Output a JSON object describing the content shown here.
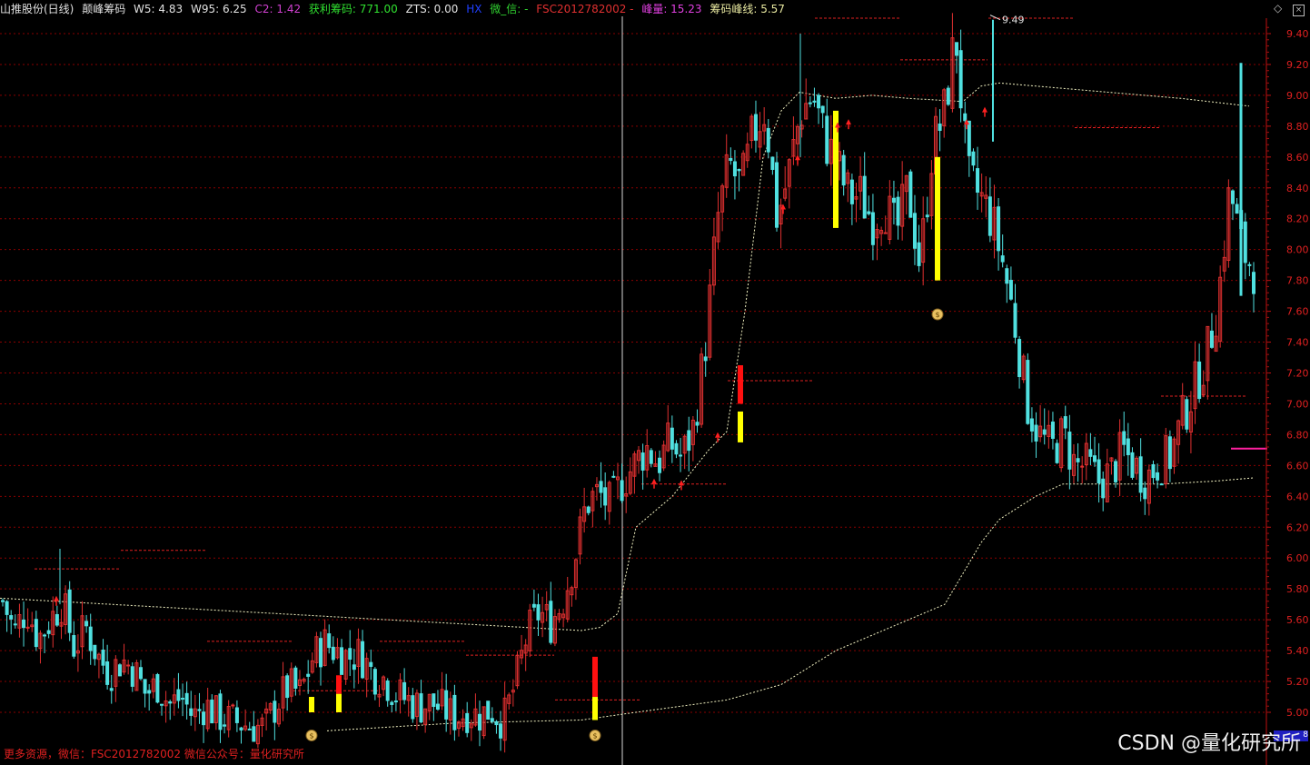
{
  "header": {
    "stock_name": "山推股份(日线)",
    "indicator_name": "颠峰筹码",
    "w5": "W5: 4.83",
    "w95": "W95: 6.25",
    "c2": "C2: 1.42",
    "profit_chips": "获利筹码: 771.00",
    "zts": "ZTS: 0.00",
    "hx": "HX",
    "weixin": "微_信: -",
    "fsc": "FSC2012782002 -",
    "peak": "峰量: 15.23",
    "ridge": "筹码峰线: 5.57"
  },
  "top_icons": [
    "diamond-icon",
    "close-box-icon"
  ],
  "footer_note": "更多资源，微信：FSC2012782002 微信公众号：量化研究所",
  "watermark": "CSDN @量化研究所",
  "corner_tag": "8",
  "max_label": "9.49",
  "colors": {
    "up": "#e03030",
    "down": "#50e0e0",
    "grid": "#8a0000",
    "axis_text": "#e02020",
    "ma": "#f0f0c0",
    "signal_yellow": "#ffff00",
    "signal_red": "#ff1010",
    "magenta": "#ff20a0"
  },
  "chart_data": {
    "type": "candlestick",
    "title": "",
    "ylim": [
      4.85,
      9.55
    ],
    "yticks": [
      "9.40",
      "9.20",
      "9.00",
      "8.80",
      "8.60",
      "8.40",
      "8.20",
      "8.00",
      "7.80",
      "7.60",
      "7.40",
      "7.20",
      "7.00",
      "6.80",
      "6.60",
      "6.40",
      "6.20",
      "6.00",
      "5.80",
      "5.60",
      "5.40",
      "5.20",
      "5.00"
    ],
    "grid": true,
    "close_anchors": [
      5.72,
      5.52,
      5.68,
      5.48,
      5.6,
      5.72,
      5.42,
      5.55,
      5.36,
      5.26,
      5.34,
      5.28,
      5.12,
      5.18,
      5.05,
      5.1,
      4.97,
      5.05,
      4.98,
      4.95,
      4.93,
      4.91,
      4.9,
      5.06,
      5.17,
      5.12,
      5.35,
      5.45,
      5.4,
      5.36,
      5.38,
      5.26,
      5.22,
      5.12,
      5.08,
      5.04,
      5.06,
      5.02,
      4.97,
      5.0,
      4.98,
      5.02,
      4.94,
      5.18,
      5.5,
      5.65,
      5.58,
      5.72,
      6.0,
      6.36,
      6.42,
      6.34,
      6.5,
      6.6,
      6.72,
      6.62,
      6.75,
      6.65,
      6.85,
      7.4,
      8.2,
      8.55,
      8.4,
      8.75,
      8.92,
      8.2,
      8.5,
      8.9,
      9.0,
      8.72,
      8.55,
      8.35,
      8.35,
      8.2,
      8.3,
      8.1,
      8.4,
      7.9,
      8.65,
      8.88,
      9.4,
      8.45,
      8.35,
      8.2,
      7.9,
      7.5,
      7.0,
      6.8,
      6.7,
      6.8,
      6.6,
      6.6,
      6.5,
      6.55,
      6.7,
      6.6,
      6.52,
      6.62,
      6.66,
      6.9,
      7.1,
      7.3,
      7.65,
      8.4,
      8.0,
      7.88
    ],
    "ma_long": [
      [
        0,
        5.74
      ],
      [
        640,
        5.53
      ],
      [
        660,
        5.55
      ],
      [
        680,
        5.64
      ],
      [
        700,
        6.2
      ],
      [
        740,
        6.4
      ],
      [
        780,
        6.7
      ],
      [
        800,
        6.82
      ],
      [
        820,
        7.6
      ],
      [
        840,
        8.6
      ],
      [
        860,
        8.9
      ],
      [
        880,
        9.02
      ],
      [
        920,
        8.98
      ],
      [
        960,
        9.0
      ],
      [
        1000,
        8.98
      ],
      [
        1060,
        8.96
      ],
      [
        1080,
        9.06
      ],
      [
        1100,
        9.08
      ],
      [
        1200,
        9.03
      ],
      [
        1300,
        8.98
      ],
      [
        1375,
        8.93
      ]
    ],
    "ma_low": [
      [
        360,
        4.88
      ],
      [
        500,
        4.93
      ],
      [
        640,
        4.95
      ],
      [
        700,
        5.0
      ],
      [
        800,
        5.08
      ],
      [
        860,
        5.18
      ],
      [
        920,
        5.4
      ],
      [
        960,
        5.5
      ],
      [
        1000,
        5.6
      ],
      [
        1040,
        5.7
      ],
      [
        1060,
        5.9
      ],
      [
        1080,
        6.1
      ],
      [
        1100,
        6.25
      ],
      [
        1140,
        6.4
      ],
      [
        1170,
        6.48
      ],
      [
        1280,
        6.48
      ],
      [
        1340,
        6.5
      ],
      [
        1380,
        6.52
      ]
    ],
    "resistance_levels": [
      {
        "x0": 38,
        "x1": 132,
        "price": 5.93
      },
      {
        "x0": 133,
        "x1": 228,
        "price": 6.05
      },
      {
        "x0": 228,
        "x1": 322,
        "price": 5.46
      },
      {
        "x0": 323,
        "x1": 417,
        "price": 5.14
      },
      {
        "x0": 418,
        "x1": 512,
        "price": 5.46
      },
      {
        "x0": 513,
        "x1": 610,
        "price": 5.37
      },
      {
        "x0": 611,
        "x1": 705,
        "price": 5.08
      },
      {
        "x0": 706,
        "x1": 800,
        "price": 6.48
      },
      {
        "x0": 801,
        "x1": 896,
        "price": 7.15
      },
      {
        "x0": 897,
        "x1": 990,
        "price": 9.5
      },
      {
        "x0": 991,
        "x1": 1087,
        "price": 9.23
      },
      {
        "x0": 1088,
        "x1": 1182,
        "price": 9.5
      },
      {
        "x0": 1183,
        "x1": 1277,
        "price": 8.79
      },
      {
        "x0": 1278,
        "x1": 1373,
        "price": 7.05
      }
    ],
    "signal_bars": [
      {
        "x": 343,
        "lo": 5.0,
        "hi": 5.1,
        "color": "yellow"
      },
      {
        "x": 373,
        "lo": 5.0,
        "hi": 5.12,
        "color": "yellow"
      },
      {
        "x": 373,
        "lo": 5.12,
        "hi": 5.24,
        "color": "red"
      },
      {
        "x": 655,
        "lo": 4.95,
        "hi": 5.1,
        "color": "yellow"
      },
      {
        "x": 655,
        "lo": 5.1,
        "hi": 5.36,
        "color": "red"
      },
      {
        "x": 815,
        "lo": 6.75,
        "hi": 6.95,
        "color": "yellow"
      },
      {
        "x": 815,
        "lo": 7.0,
        "hi": 7.25,
        "color": "red"
      },
      {
        "x": 920,
        "lo": 8.14,
        "hi": 8.9,
        "color": "yellow"
      },
      {
        "x": 1032,
        "lo": 7.8,
        "hi": 8.6,
        "color": "yellow"
      }
    ],
    "money_bag_x": [
      343,
      655,
      1032
    ],
    "money_bag_prices": [
      4.85,
      4.85,
      7.58
    ],
    "red_arrows": [
      [
        62,
        5.72
      ],
      [
        720,
        6.48
      ],
      [
        750,
        6.47
      ],
      [
        790,
        6.78
      ],
      [
        862,
        8.26
      ],
      [
        878,
        8.58
      ],
      [
        922,
        8.79
      ],
      [
        934,
        8.81
      ],
      [
        1064,
        8.81
      ],
      [
        1084,
        8.89
      ]
    ],
    "magenta_segment": {
      "x0": 1355,
      "x1": 1395,
      "price": 6.71
    },
    "vertical_cursor_x": 685
  }
}
